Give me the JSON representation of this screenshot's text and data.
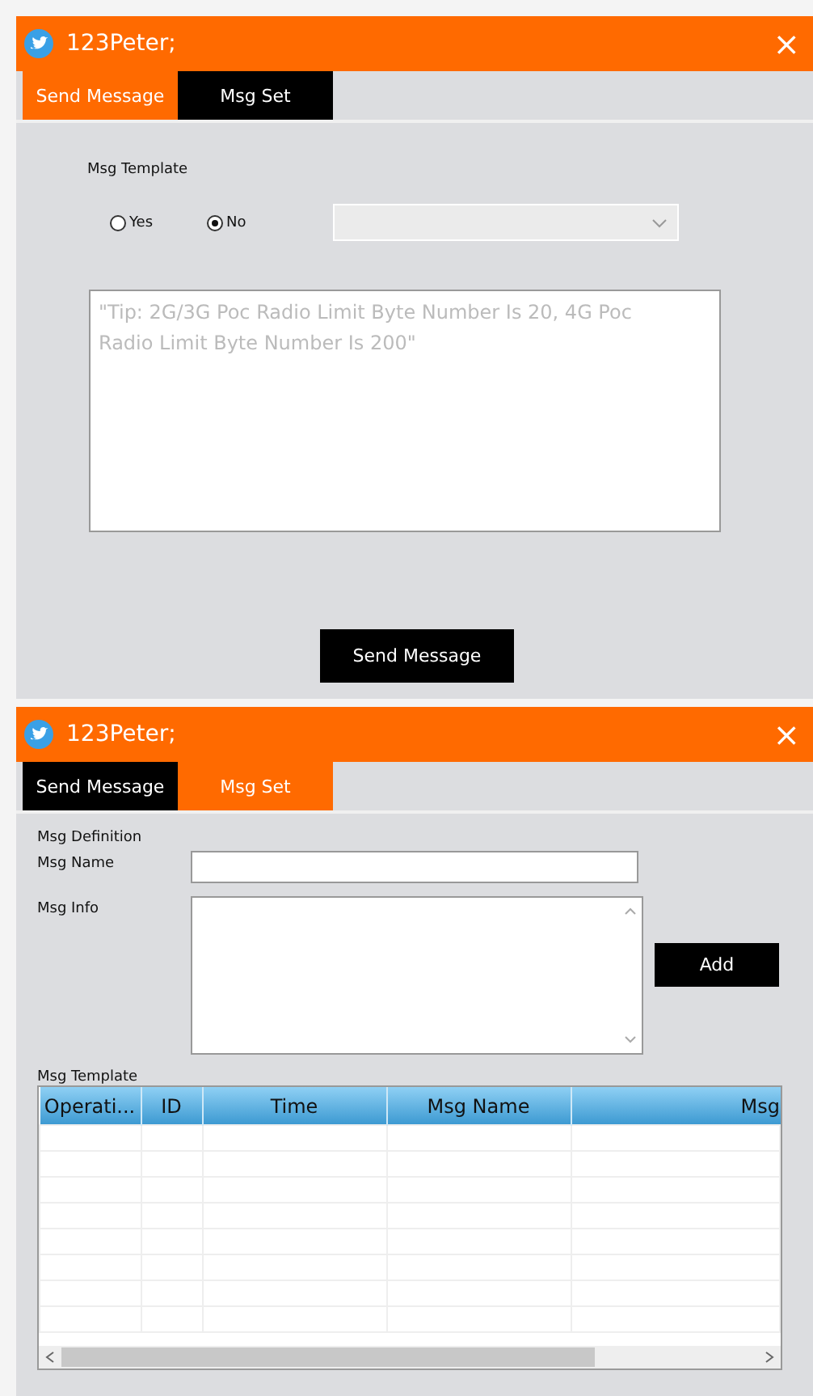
{
  "dialogs": [
    {
      "title": "123Peter;",
      "close": "×",
      "tabs": [
        {
          "label": "Send Message",
          "selected": true
        },
        {
          "label": "Msg Set",
          "selected": false
        }
      ],
      "kind": "send",
      "template_label": "Msg Template",
      "radios": [
        {
          "label": "Yes",
          "selected": false
        },
        {
          "label": "No",
          "selected": true
        }
      ],
      "message_placeholder": "\"Tip: 2G/3G Poc Radio Limit Byte Number Is 20, 4G Poc Radio Limit Byte Number Is 200\"",
      "send_button": "Send Message"
    },
    {
      "title": "123Peter;",
      "close": "×",
      "tabs": [
        {
          "label": "Send Message",
          "selected": false
        },
        {
          "label": "Msg Set",
          "selected": true
        }
      ],
      "kind": "settings",
      "definition_label": "Msg Definition",
      "name_label": "Msg Name",
      "info_label": "Msg Info",
      "add_button": "Add",
      "template_label": "Msg Template",
      "table": {
        "columns": [
          "Operati...",
          "ID",
          "Time",
          "Msg Name",
          "Msg"
        ]
      }
    }
  ]
}
